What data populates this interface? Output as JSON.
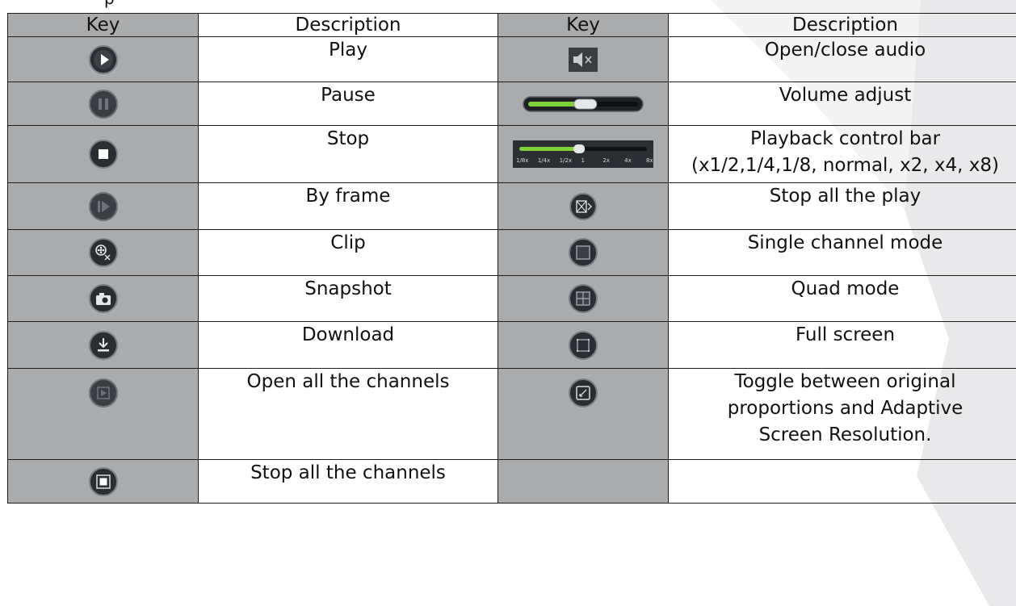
{
  "caption_fragment": "p",
  "table": {
    "headers": [
      "Key",
      "Description",
      "Key",
      "Description"
    ],
    "rows": [
      {
        "left_icon": "play-icon",
        "left_desc": "Play",
        "right_icon": "mute-speaker-icon",
        "right_desc": "Open/close audio"
      },
      {
        "left_icon": "pause-icon",
        "left_desc": "Pause",
        "right_icon": "volume-slider-icon",
        "right_desc": "Volume adjust"
      },
      {
        "left_icon": "stop-icon",
        "left_desc": "Stop",
        "right_icon": "playback-speed-bar-icon",
        "right_desc": "Playback control bar",
        "right_desc2": "(x1/2,1/4,1/8, normal, x2, x4, x8)"
      },
      {
        "left_icon": "frame-step-icon",
        "left_desc": "By frame",
        "right_icon": "stop-all-play-icon",
        "right_desc": "Stop all the play"
      },
      {
        "left_icon": "clip-scissors-icon",
        "left_desc": "Clip",
        "right_icon": "single-channel-icon",
        "right_desc": "Single channel mode"
      },
      {
        "left_icon": "camera-icon",
        "left_desc": "Snapshot",
        "right_icon": "quad-grid-icon",
        "right_desc": "Quad mode"
      },
      {
        "left_icon": "download-icon",
        "left_desc": "Download",
        "right_icon": "fullscreen-icon",
        "right_desc": "Full screen"
      },
      {
        "left_icon": "open-all-channels-icon",
        "left_desc": "Open all the channels",
        "right_icon": "aspect-toggle-icon",
        "right_desc": "Toggle between original",
        "right_desc2": "proportions and Adaptive",
        "right_desc3": "Screen Resolution."
      },
      {
        "left_icon": "stop-all-channels-icon",
        "left_desc": "Stop all the channels",
        "right_icon": "",
        "right_desc": ""
      }
    ]
  },
  "speed_bar": {
    "labels": [
      "1/8x",
      "1/4x",
      "1/2x",
      "1",
      "2x",
      "4x",
      "8x"
    ],
    "position": 0.45
  },
  "volume_level": 0.55,
  "colors": {
    "key_cell_bg": "#a9abad",
    "icon_dark": "#2a2d31",
    "icon_rim": "#7a7f86",
    "slider_green": "#7fd13a",
    "background_shape": "#e8e8ea"
  }
}
